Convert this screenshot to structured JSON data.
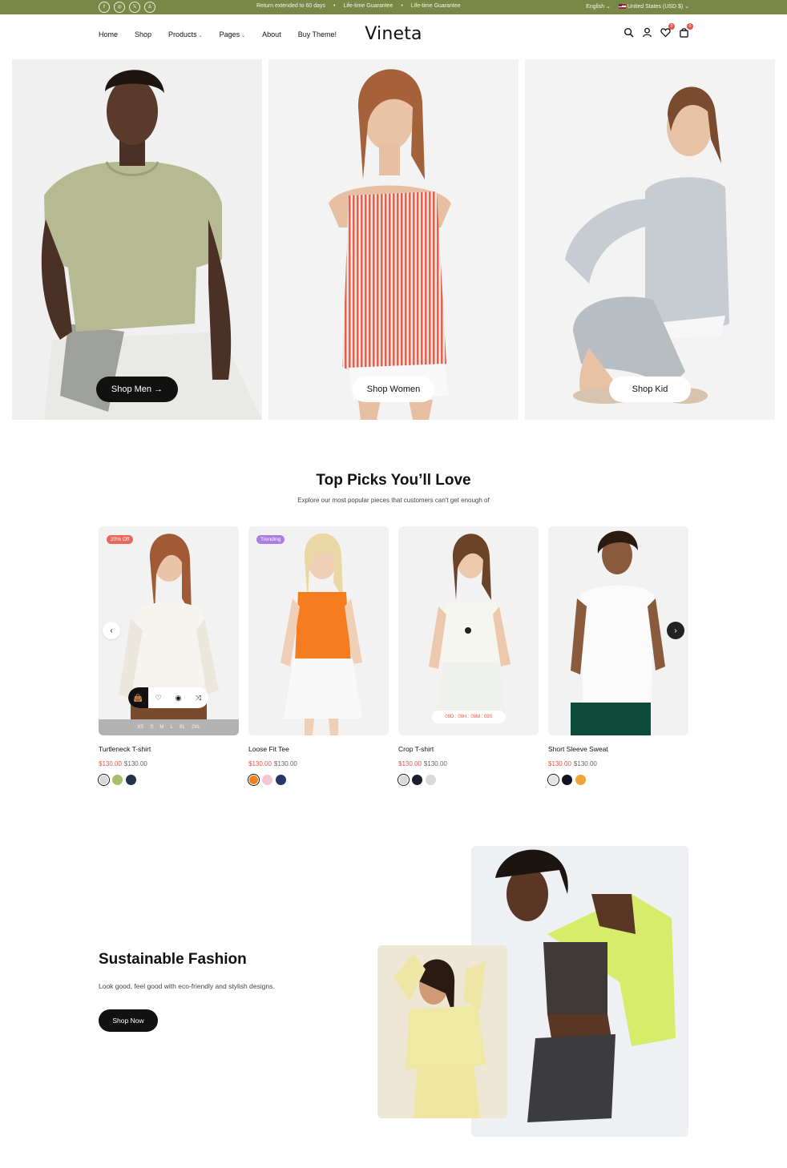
{
  "topbar": {
    "socials": [
      {
        "icon": "facebook-icon",
        "glyph": "f"
      },
      {
        "icon": "instagram-icon",
        "glyph": "◎"
      },
      {
        "icon": "x-icon",
        "glyph": "𝕏"
      },
      {
        "icon": "snapchat-icon",
        "glyph": "♙"
      }
    ],
    "announcements": [
      "Return extended to 60 days",
      "Life-time Guarantee",
      "Life-time Guarantee"
    ],
    "separator": "•",
    "language": "English",
    "currency": "United States (USD $)",
    "bg_color": "#7a8847"
  },
  "header": {
    "nav": [
      {
        "label": "Home",
        "dropdown": false
      },
      {
        "label": "Shop",
        "dropdown": false
      },
      {
        "label": "Products",
        "dropdown": true
      },
      {
        "label": "Pages",
        "dropdown": true
      },
      {
        "label": "About",
        "dropdown": false
      },
      {
        "label": "Buy Theme!",
        "dropdown": false
      }
    ],
    "logo": "Vineta",
    "icons": [
      "search-icon",
      "user-icon",
      "heart-icon",
      "bag-icon"
    ],
    "wishlist_count": "0",
    "cart_count": "0"
  },
  "hero": {
    "tiles": [
      {
        "button": "Shop Men",
        "arrow": "→",
        "style": "dark"
      },
      {
        "button": "Shop Women",
        "style": "light"
      },
      {
        "button": "Shop Kid",
        "style": "light"
      }
    ]
  },
  "top_picks": {
    "title": "Top Picks You’ll Love",
    "subtitle": "Explore our most popular pieces that customers can't get enough of",
    "prev_arrow": "‹",
    "next_arrow": "›",
    "products": [
      {
        "name": "Turtleneck T-shirt",
        "badge": "20% Off",
        "badge_type": "sale",
        "sale_price": "$130.00",
        "old_price": "$130.00",
        "sizes": [
          "XS",
          "S",
          "M",
          "L",
          "XL",
          "2XL"
        ],
        "swatches": [
          "#d7d7d7",
          "#a9c06b",
          "#25304a"
        ],
        "action_icons": [
          "bag-icon",
          "heart-icon",
          "eye-icon",
          "shuffle-icon"
        ],
        "action_glyphs": [
          "👜",
          "♡",
          "◉",
          "⤨"
        ]
      },
      {
        "name": "Loose Fit Tee",
        "badge": "Trending",
        "badge_type": "trend",
        "sale_price": "$130.00",
        "old_price": "$130.00",
        "swatches": [
          "#f0821e",
          "#f4c6d2",
          "#26376a"
        ]
      },
      {
        "name": "Crop T-shirt",
        "countdown": "09D : 09H : 09M : 09S",
        "sale_price": "$130.00",
        "old_price": "$130.00",
        "swatches": [
          "#d9d9d9",
          "#1b1f2e",
          "#d9d9d9"
        ]
      },
      {
        "name": "Short Sleeve Sweat",
        "sale_price": "$130.00",
        "old_price": "$130.00",
        "swatches": [
          "#e3e3e3",
          "#111522",
          "#f2a33a"
        ]
      }
    ]
  },
  "sustainable": {
    "title": "Sustainable Fashion",
    "subtitle": "Look good, feel good with eco-friendly and stylish designs.",
    "button": "Shop Now"
  }
}
